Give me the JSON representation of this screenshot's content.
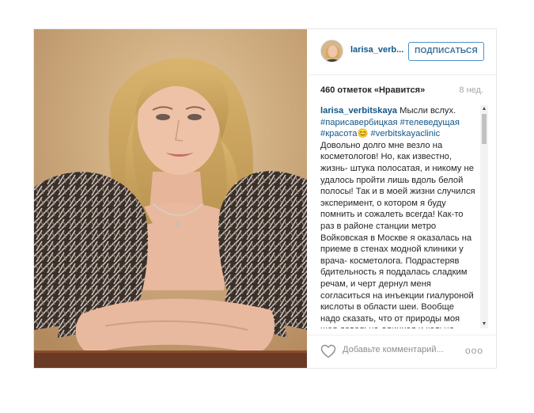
{
  "post": {
    "username": "larisa_verbitskaya",
    "username_short": "larisa_verb...",
    "follow_label": "ПОДПИСАТЬСЯ",
    "likes": "460 отметок «Нравится»",
    "age": "8 нед.",
    "caption": {
      "author": "larisa_verbitskaya",
      "text_1": " Мысли вслух. ",
      "tag_1": "#парисавербицкая",
      "tag_2": "#телеведущая",
      "tag_3": "#красота",
      "emoji": "😊",
      "tag_4": "#verbitskayaclinic",
      "text_2": " Довольно долго мне везло на косметологов! Но, как известно, жизнь- штука полосатая, и никому не удалось пройти лишь вдоль белой полосы! Так и в моей жизни случился эксперимент, о котором я буду помнить и сожалеть всегда! Как-то раз в районе станции метро Войковская в Москве я оказалась на приеме в стенах модной клиники у врача- косметолога. Подрастеряв бдительность я поддалась сладким речам, и черт дернул меня согласиться на инъекции гиалуроной кислоты в области шеи. Вообще надо сказать, что от природы моя шея довольна длинная и кольца Венеры у меня были всегда, сколько себя помню. Как говорится, нет предела совершенству! А ведь на"
    },
    "comment_placeholder": "Добавьте комментарий...",
    "more_label": "ooo"
  },
  "icons": {
    "heart": "heart-icon",
    "more": "more-options-icon",
    "scroll_up": "scroll-up-arrow-icon",
    "scroll_down": "scroll-down-arrow-icon"
  },
  "colors": {
    "link": "#125688",
    "follow_border": "#4e90c7",
    "muted": "#a5a7aa"
  }
}
